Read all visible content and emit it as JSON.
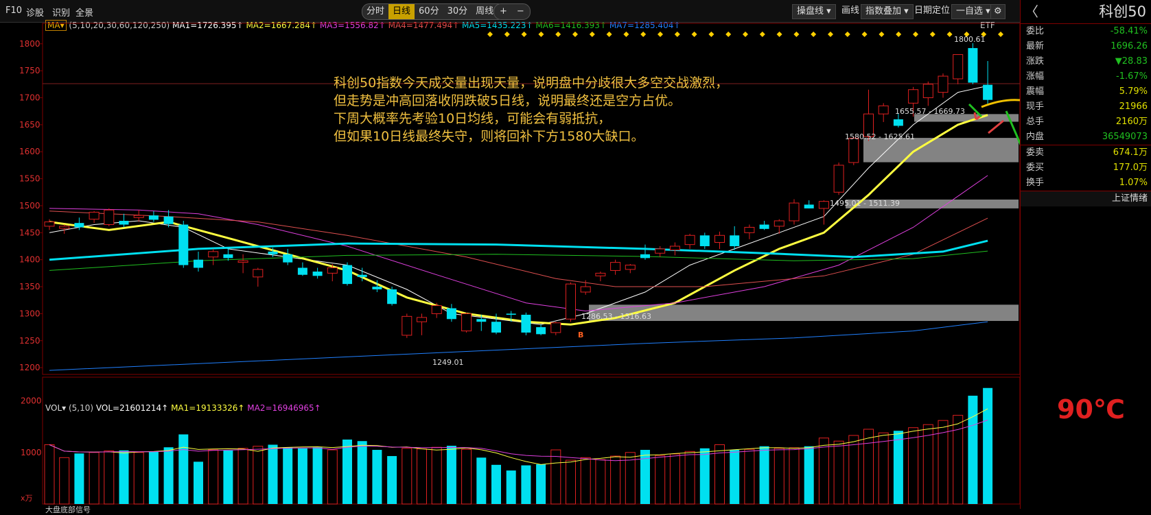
{
  "topbar": {
    "left_items": [
      "F10",
      "诊股",
      "识别",
      "全景"
    ],
    "period_tabs": [
      "分时",
      "日线",
      "60分",
      "30分",
      "周线 ▾"
    ],
    "active_tab": "日线",
    "zoom_in": "+",
    "zoom_out": "−",
    "right_buttons": [
      "操盘线 ▾",
      "画线",
      "指数叠加 ▾",
      "日期定位",
      "一自选 ▾"
    ]
  },
  "ma_legend": {
    "toggle": "MA▾",
    "params": "(5,10,20,30,60,120,250)",
    "ma1": "MA1=1726.395↑",
    "ma2": "MA2=1667.284↑",
    "ma3": "MA3=1556.82↑",
    "ma4": "MA4=1477.494↑",
    "ma5": "MA5=1435.223↑",
    "ma6": "MA6=1416.393↑",
    "ma7": "MA7=1285.404↑"
  },
  "etf_label": "ETF",
  "price_axis": [
    "1800",
    "1750",
    "1700",
    "1650",
    "1600",
    "1550",
    "1500",
    "1450",
    "1400",
    "1350",
    "1300",
    "1250",
    "1200"
  ],
  "vol_axis": [
    "2000",
    "1000"
  ],
  "vol_unit": "x万",
  "vol_legend": {
    "toggle": "VOL▾",
    "params": "(5,10)",
    "vol": "VOL=21601214↑",
    "ma1": "MA1=19133326↑",
    "ma2": "MA2=16946965↑"
  },
  "annotation": [
    "科创50指数今天成交量出现天量，说明盘中分歧很大多空交战激烈，",
    "但走势是冲高回落收阴跌破5日线，说明最终还是空方占优。",
    "下周大概率先考验10日均线，可能会有弱抵抗，",
    "但如果10日线最终失守，则将回补下方1580大缺口。"
  ],
  "price_labels": {
    "high": "1800.61",
    "low": "1249.01",
    "gap1": "1655.57 - 1669.73",
    "gap2": "1580.52 - 1625.61",
    "gap3": "1495.01 - 1511.39",
    "gap4": "1286.53 - 1316.63",
    "b_marker": "B"
  },
  "panel": {
    "back": "〈",
    "title": "科创50",
    "rows": [
      {
        "k": "委比",
        "v": "-58.41%",
        "c": "#20c020"
      },
      {
        "k": "最新",
        "v": "1696.26",
        "c": "#20c020"
      },
      {
        "k": "涨跌",
        "v": "▼28.83",
        "c": "#20c020"
      },
      {
        "k": "涨幅",
        "v": "-1.67%",
        "c": "#20c020"
      },
      {
        "k": "震幅",
        "v": "5.79%",
        "c": "#e0e000"
      },
      {
        "k": "现手",
        "v": "21966",
        "c": "#e0e000"
      },
      {
        "k": "总手",
        "v": "2160万",
        "c": "#e0e000"
      },
      {
        "k": "内盘",
        "v": "36549073",
        "c": "#20c020"
      },
      {
        "k": "委卖",
        "v": "674.1万",
        "c": "#e0e000"
      },
      {
        "k": "委买",
        "v": "177.0万",
        "c": "#e0e000"
      },
      {
        "k": "换手",
        "v": "1.07%",
        "c": "#e0e000"
      }
    ],
    "link": "上证情绪",
    "temperature": "90℃"
  },
  "bottom_tab": "大盘底部信号",
  "colors": {
    "up": "#e02020",
    "down": "#00e0f0",
    "ma5": "#ffffff",
    "ma10": "#ffff40",
    "ma20": "#e040e0",
    "ma30": "#e05050",
    "ma60": "#00e0f0",
    "ma120": "#20c020",
    "ma250": "#2080ff"
  },
  "chart_data": {
    "type": "candlestick",
    "ylim": [
      1190,
      1815
    ],
    "candles": [
      [
        1462,
        1475,
        1455,
        1470
      ],
      [
        1458,
        1465,
        1448,
        1462
      ],
      [
        1468,
        1478,
        1455,
        1460
      ],
      [
        1475,
        1490,
        1468,
        1488
      ],
      [
        1465,
        1495,
        1462,
        1492
      ],
      [
        1472,
        1485,
        1460,
        1465
      ],
      [
        1478,
        1492,
        1470,
        1482
      ],
      [
        1482,
        1490,
        1470,
        1474
      ],
      [
        1480,
        1492,
        1460,
        1466
      ],
      [
        1465,
        1472,
        1385,
        1390
      ],
      [
        1400,
        1415,
        1378,
        1385
      ],
      [
        1405,
        1420,
        1390,
        1415
      ],
      [
        1410,
        1420,
        1398,
        1403
      ],
      [
        1395,
        1410,
        1375,
        1398
      ],
      [
        1368,
        1385,
        1350,
        1382
      ],
      [
        1415,
        1422,
        1405,
        1410
      ],
      [
        1410,
        1420,
        1390,
        1395
      ],
      [
        1385,
        1395,
        1370,
        1372
      ],
      [
        1378,
        1385,
        1365,
        1370
      ],
      [
        1375,
        1392,
        1360,
        1385
      ],
      [
        1390,
        1395,
        1352,
        1355
      ],
      [
        1372,
        1385,
        1360,
        1368
      ],
      [
        1350,
        1362,
        1340,
        1345
      ],
      [
        1345,
        1350,
        1315,
        1318
      ],
      [
        1260,
        1300,
        1255,
        1295
      ],
      [
        1285,
        1300,
        1260,
        1293
      ],
      [
        1300,
        1320,
        1292,
        1315
      ],
      [
        1310,
        1318,
        1285,
        1290
      ],
      [
        1268,
        1302,
        1265,
        1300
      ],
      [
        1290,
        1298,
        1268,
        1285
      ],
      [
        1285,
        1300,
        1262,
        1265
      ],
      [
        1300,
        1305,
        1285,
        1298
      ],
      [
        1298,
        1302,
        1260,
        1265
      ],
      [
        1275,
        1280,
        1260,
        1262
      ],
      [
        1265,
        1285,
        1260,
        1283
      ],
      [
        1290,
        1358,
        1285,
        1355
      ],
      [
        1340,
        1362,
        1335,
        1350
      ],
      [
        1370,
        1378,
        1360,
        1375
      ],
      [
        1380,
        1400,
        1372,
        1395
      ],
      [
        1382,
        1392,
        1375,
        1390
      ],
      [
        1410,
        1428,
        1400,
        1403
      ],
      [
        1412,
        1425,
        1405,
        1420
      ],
      [
        1418,
        1432,
        1408,
        1425
      ],
      [
        1428,
        1448,
        1420,
        1445
      ],
      [
        1445,
        1450,
        1420,
        1425
      ],
      [
        1432,
        1452,
        1420,
        1445
      ],
      [
        1445,
        1462,
        1418,
        1425
      ],
      [
        1450,
        1465,
        1438,
        1460
      ],
      [
        1465,
        1472,
        1455,
        1457
      ],
      [
        1462,
        1475,
        1448,
        1472
      ],
      [
        1472,
        1512,
        1465,
        1505
      ],
      [
        1502,
        1510,
        1495,
        1495
      ],
      [
        1495,
        1510,
        1465,
        1508
      ],
      [
        1525,
        1580,
        1520,
        1575
      ],
      [
        1580,
        1628,
        1575,
        1625
      ],
      [
        1628,
        1715,
        1620,
        1670
      ],
      [
        1670,
        1690,
        1655,
        1685
      ],
      [
        1660,
        1670,
        1645,
        1648
      ],
      [
        1690,
        1720,
        1665,
        1715
      ],
      [
        1700,
        1730,
        1685,
        1725
      ],
      [
        1710,
        1745,
        1700,
        1740
      ],
      [
        1735,
        1780,
        1725,
        1780
      ],
      [
        1792,
        1801,
        1725,
        1728
      ],
      [
        1724,
        1768,
        1688,
        1696
      ]
    ],
    "volumes": [
      1150,
      900,
      980,
      1000,
      1030,
      1040,
      1000,
      1020,
      1100,
      1350,
      820,
      1050,
      1040,
      1080,
      1120,
      1150,
      1100,
      1080,
      1100,
      1050,
      1250,
      1220,
      1050,
      930,
      1080,
      1070,
      1100,
      1130,
      1060,
      900,
      760,
      650,
      750,
      770,
      1050,
      850,
      900,
      860,
      930,
      1000,
      1050,
      940,
      970,
      1020,
      1080,
      1150,
      1050,
      1060,
      1120,
      1080,
      1090,
      1120,
      1280,
      1220,
      1330,
      1450,
      1380,
      1420,
      1480,
      1540,
      1620,
      1720,
      2100,
      2250
    ],
    "series": [
      {
        "name": "MA5",
        "points": [
          [
            0,
            1450
          ],
          [
            3,
            1465
          ],
          [
            6,
            1472
          ],
          [
            9,
            1460
          ],
          [
            12,
            1420
          ],
          [
            16,
            1405
          ],
          [
            20,
            1390
          ],
          [
            24,
            1345
          ],
          [
            27,
            1300
          ],
          [
            30,
            1290
          ],
          [
            33,
            1280
          ],
          [
            36,
            1300
          ],
          [
            40,
            1340
          ],
          [
            43,
            1390
          ],
          [
            46,
            1420
          ],
          [
            49,
            1450
          ],
          [
            52,
            1480
          ],
          [
            55,
            1570
          ],
          [
            58,
            1650
          ],
          [
            61,
            1710
          ],
          [
            63,
            1722
          ]
        ]
      },
      {
        "name": "MA10",
        "points": [
          [
            0,
            1470
          ],
          [
            4,
            1455
          ],
          [
            8,
            1470
          ],
          [
            12,
            1440
          ],
          [
            16,
            1410
          ],
          [
            20,
            1380
          ],
          [
            24,
            1330
          ],
          [
            28,
            1300
          ],
          [
            32,
            1285
          ],
          [
            35,
            1280
          ],
          [
            38,
            1292
          ],
          [
            42,
            1320
          ],
          [
            46,
            1380
          ],
          [
            49,
            1420
          ],
          [
            52,
            1450
          ],
          [
            55,
            1520
          ],
          [
            58,
            1600
          ],
          [
            61,
            1650
          ],
          [
            63,
            1668
          ]
        ]
      },
      {
        "name": "MA20",
        "points": [
          [
            0,
            1495
          ],
          [
            6,
            1492
          ],
          [
            10,
            1485
          ],
          [
            14,
            1465
          ],
          [
            20,
            1425
          ],
          [
            26,
            1372
          ],
          [
            32,
            1320
          ],
          [
            36,
            1305
          ],
          [
            42,
            1320
          ],
          [
            48,
            1350
          ],
          [
            53,
            1390
          ],
          [
            58,
            1460
          ],
          [
            63,
            1556
          ]
        ]
      },
      {
        "name": "MA30",
        "points": [
          [
            0,
            1490
          ],
          [
            8,
            1480
          ],
          [
            14,
            1470
          ],
          [
            20,
            1445
          ],
          [
            28,
            1405
          ],
          [
            34,
            1365
          ],
          [
            38,
            1350
          ],
          [
            44,
            1350
          ],
          [
            52,
            1370
          ],
          [
            58,
            1410
          ],
          [
            63,
            1477
          ]
        ]
      },
      {
        "name": "MA60",
        "points": [
          [
            0,
            1400
          ],
          [
            10,
            1420
          ],
          [
            20,
            1430
          ],
          [
            30,
            1428
          ],
          [
            40,
            1420
          ],
          [
            48,
            1412
          ],
          [
            54,
            1405
          ],
          [
            60,
            1415
          ],
          [
            63,
            1435
          ]
        ]
      },
      {
        "name": "MA120",
        "points": [
          [
            0,
            1380
          ],
          [
            10,
            1398
          ],
          [
            20,
            1408
          ],
          [
            30,
            1410
          ],
          [
            40,
            1406
          ],
          [
            50,
            1398
          ],
          [
            58,
            1402
          ],
          [
            63,
            1416
          ]
        ]
      },
      {
        "name": "MA250",
        "points": [
          [
            0,
            1195
          ],
          [
            20,
            1220
          ],
          [
            40,
            1245
          ],
          [
            50,
            1255
          ],
          [
            58,
            1268
          ],
          [
            63,
            1285
          ]
        ]
      }
    ],
    "gaps": [
      [
        1655.57,
        1669.73
      ],
      [
        1580.52,
        1625.61
      ],
      [
        1495.01,
        1511.39
      ],
      [
        1286.53,
        1316.63
      ]
    ]
  }
}
